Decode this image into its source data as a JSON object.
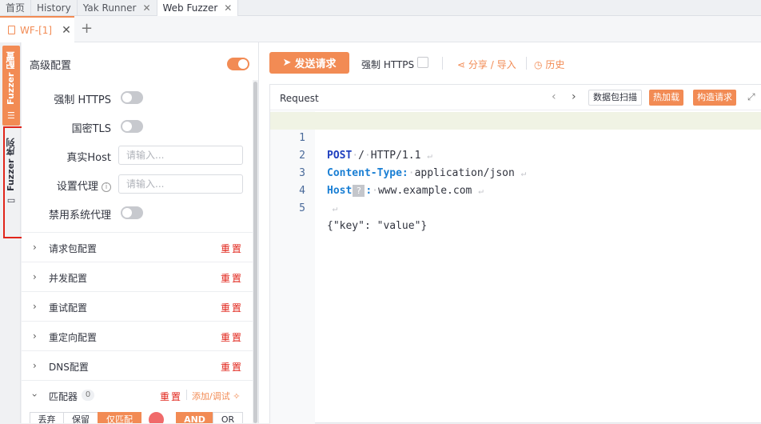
{
  "tabs": [
    {
      "label": "首页",
      "closable": false,
      "active": false
    },
    {
      "label": "History",
      "closable": false,
      "active": false
    },
    {
      "label": "Yak Runner",
      "closable": true,
      "active": false
    },
    {
      "label": "Web Fuzzer",
      "closable": true,
      "active": true
    }
  ],
  "subtab": {
    "label": "WF-[1]",
    "close_glyph": "✕",
    "add_glyph": "+"
  },
  "vertical_tabs": {
    "config": "Fuzzer 配置",
    "sequence": "Fuzzer 序列"
  },
  "left": {
    "advanced": {
      "label": "高级配置",
      "enabled": true
    },
    "force_https": {
      "label": "强制 HTTPS",
      "enabled": false
    },
    "gm_tls": {
      "label": "国密TLS",
      "enabled": false
    },
    "real_host": {
      "label": "真实Host",
      "placeholder": "请输入..."
    },
    "proxy": {
      "label": "设置代理",
      "placeholder": "请输入..."
    },
    "disable_sys_proxy": {
      "label": "禁用系统代理",
      "enabled": false
    },
    "sections": [
      {
        "title": "请求包配置",
        "reset": "重置"
      },
      {
        "title": "并发配置",
        "reset": "重置"
      },
      {
        "title": "重试配置",
        "reset": "重置"
      },
      {
        "title": "重定向配置",
        "reset": "重置"
      },
      {
        "title": "DNS配置",
        "reset": "重置"
      }
    ],
    "matcher": {
      "title": "匹配器",
      "count": "0",
      "reset": "重置",
      "add": "添加/调试",
      "modes": [
        "丢弃",
        "保留",
        "仅匹配"
      ],
      "active_mode": "仅匹配",
      "color": "#f06a6a",
      "logic": [
        "AND",
        "OR"
      ],
      "active_logic": "AND"
    }
  },
  "right": {
    "send_label": "发送请求",
    "force_https_label": "强制 HTTPS",
    "share_label": "分享 / 导入",
    "history_label": "历史",
    "editor": {
      "title": "Request",
      "scan_label": "数据包扫描",
      "hot_label": "热加载",
      "build_label": "构造请求",
      "lines": [
        {
          "num": "1",
          "method": "POST",
          "path": "/",
          "proto": "HTTP/1.1"
        },
        {
          "num": "2",
          "header": "Content-Type:",
          "value": "application/json"
        },
        {
          "num": "3",
          "header": "Host",
          "marker": "?",
          "colon": ":",
          "value": "www.example.com"
        },
        {
          "num": "4"
        },
        {
          "num": "5",
          "body": "{\"key\": \"value\"}"
        }
      ]
    }
  },
  "colors": {
    "accent": "#f28b54",
    "danger": "#e1251b"
  }
}
